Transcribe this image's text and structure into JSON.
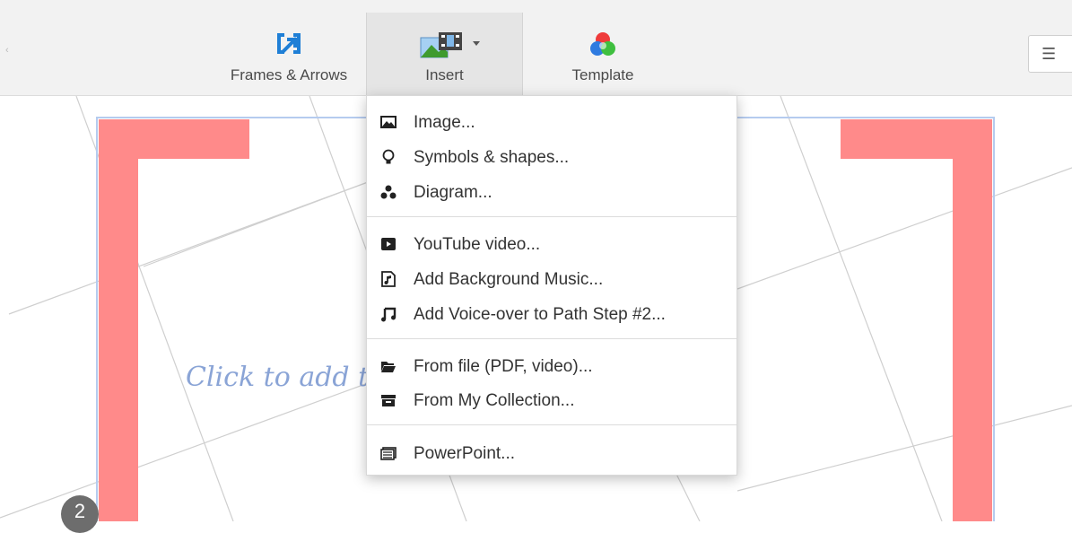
{
  "toolbar": {
    "frames_label": "Frames & Arrows",
    "insert_label": "Insert",
    "template_label": "Template",
    "menu_icon": "hamburger-icon"
  },
  "canvas": {
    "placeholder": "Click to add text",
    "step_number": "2",
    "bracket_color": "#ff8a8a",
    "frame_color": "#b5cbef"
  },
  "insert_menu": {
    "items": [
      {
        "label": "Image...",
        "icon": "image-icon"
      },
      {
        "label": "Symbols & shapes...",
        "icon": "lightbulb-icon"
      },
      {
        "label": "Diagram...",
        "icon": "diagram-icon"
      },
      {
        "label": "YouTube video...",
        "icon": "youtube-icon"
      },
      {
        "label": "Add Background Music...",
        "icon": "music-file-icon"
      },
      {
        "label": "Add Voice-over to Path Step #2...",
        "icon": "music-note-icon"
      },
      {
        "label": "From file (PDF, video)...",
        "icon": "folder-open-icon"
      },
      {
        "label": "From My Collection...",
        "icon": "archive-icon"
      },
      {
        "label": "PowerPoint...",
        "icon": "slides-icon"
      }
    ]
  }
}
